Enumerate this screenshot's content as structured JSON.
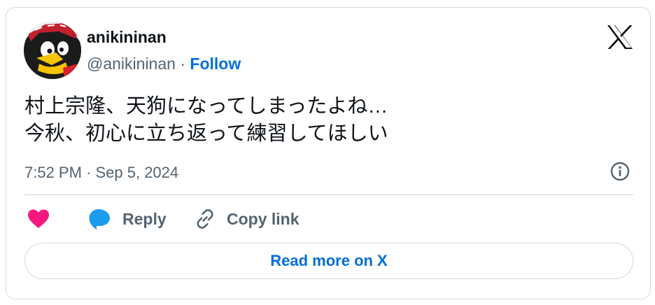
{
  "author": {
    "display_name": "anikininan",
    "handle": "@anikininan",
    "separator": " · ",
    "follow_label": "Follow"
  },
  "tweet": {
    "lines": [
      "村上宗隆、天狗になってしまったよね…",
      "今秋、初心に立ち返って練習してほしい"
    ],
    "timestamp": "7:52 PM · Sep 5, 2024"
  },
  "actions": {
    "reply_label": "Reply",
    "copy_link_label": "Copy link"
  },
  "read_more_label": "Read more on X",
  "colors": {
    "text_primary": "#0f1419",
    "text_secondary": "#536471",
    "link_blue": "#006fd6",
    "like_pink": "#f91880",
    "reply_blue": "#1d9bf0",
    "border": "#cfd9de"
  },
  "icons": {
    "brand": "x-logo-icon",
    "info": "info-icon",
    "like": "heart-icon",
    "reply": "speech-bubble-icon",
    "copy_link": "link-icon"
  }
}
